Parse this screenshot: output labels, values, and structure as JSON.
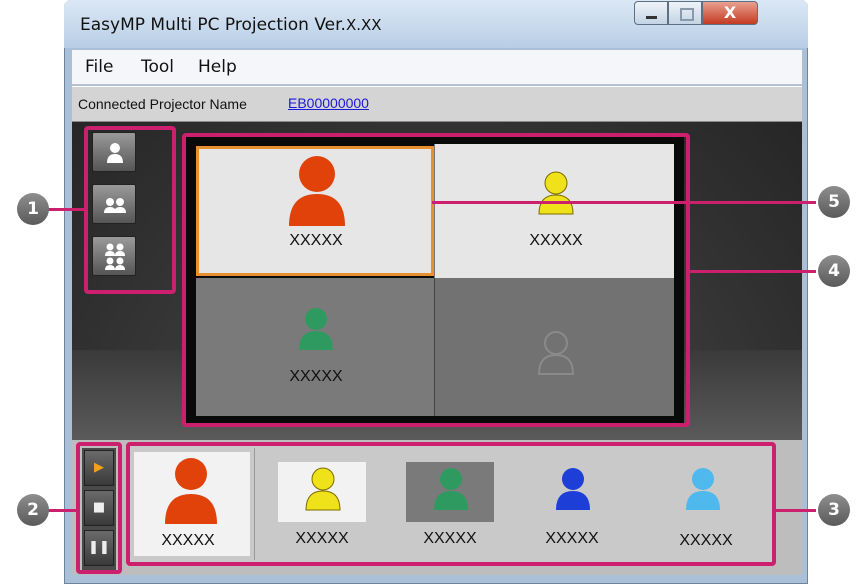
{
  "window": {
    "title": "EasyMP Multi PC Projection Ver.",
    "version": "X.XX",
    "min_icon": "minimize-icon",
    "max_icon": "maximize-icon",
    "close_icon": "close-icon",
    "close_glyph": "X"
  },
  "menu": {
    "items": [
      {
        "label": "File"
      },
      {
        "label": "Tool"
      },
      {
        "label": "Help"
      }
    ]
  },
  "info": {
    "label": "Connected Projector Name",
    "projector": "EB00000000"
  },
  "layout_buttons": [
    {
      "icon": "single-user-icon"
    },
    {
      "icon": "two-users-icon"
    },
    {
      "icon": "four-users-icon"
    }
  ],
  "projection": {
    "cells": [
      {
        "name": "XXXXX",
        "color": "#e0420a",
        "selected": true
      },
      {
        "name": "XXXXX",
        "color": "#f0e21a",
        "selected": false
      },
      {
        "name": "XXXXX",
        "color": "#2f9a60",
        "selected": false
      },
      {
        "name": "",
        "color": "#8a8a8a",
        "selected": false
      }
    ]
  },
  "controls": [
    {
      "icon": "play-icon",
      "glyph": "▶"
    },
    {
      "icon": "stop-icon",
      "glyph": "■"
    },
    {
      "icon": "pause-icon",
      "glyph": "❚❚"
    }
  ],
  "users": [
    {
      "name": "XXXXX",
      "color": "#e0420a"
    },
    {
      "name": "XXXXX",
      "color": "#f0e21a"
    },
    {
      "name": "XXXXX",
      "color": "#2f9a60"
    },
    {
      "name": "XXXXX",
      "color": "#1d3fd8"
    },
    {
      "name": "XXXXX",
      "color": "#4fb8ec"
    }
  ],
  "callouts": [
    "1",
    "2",
    "3",
    "4",
    "5"
  ],
  "colors": {
    "accent": "#cc1f6e",
    "selection": "#e8902e",
    "link": "#1a1ad8"
  }
}
